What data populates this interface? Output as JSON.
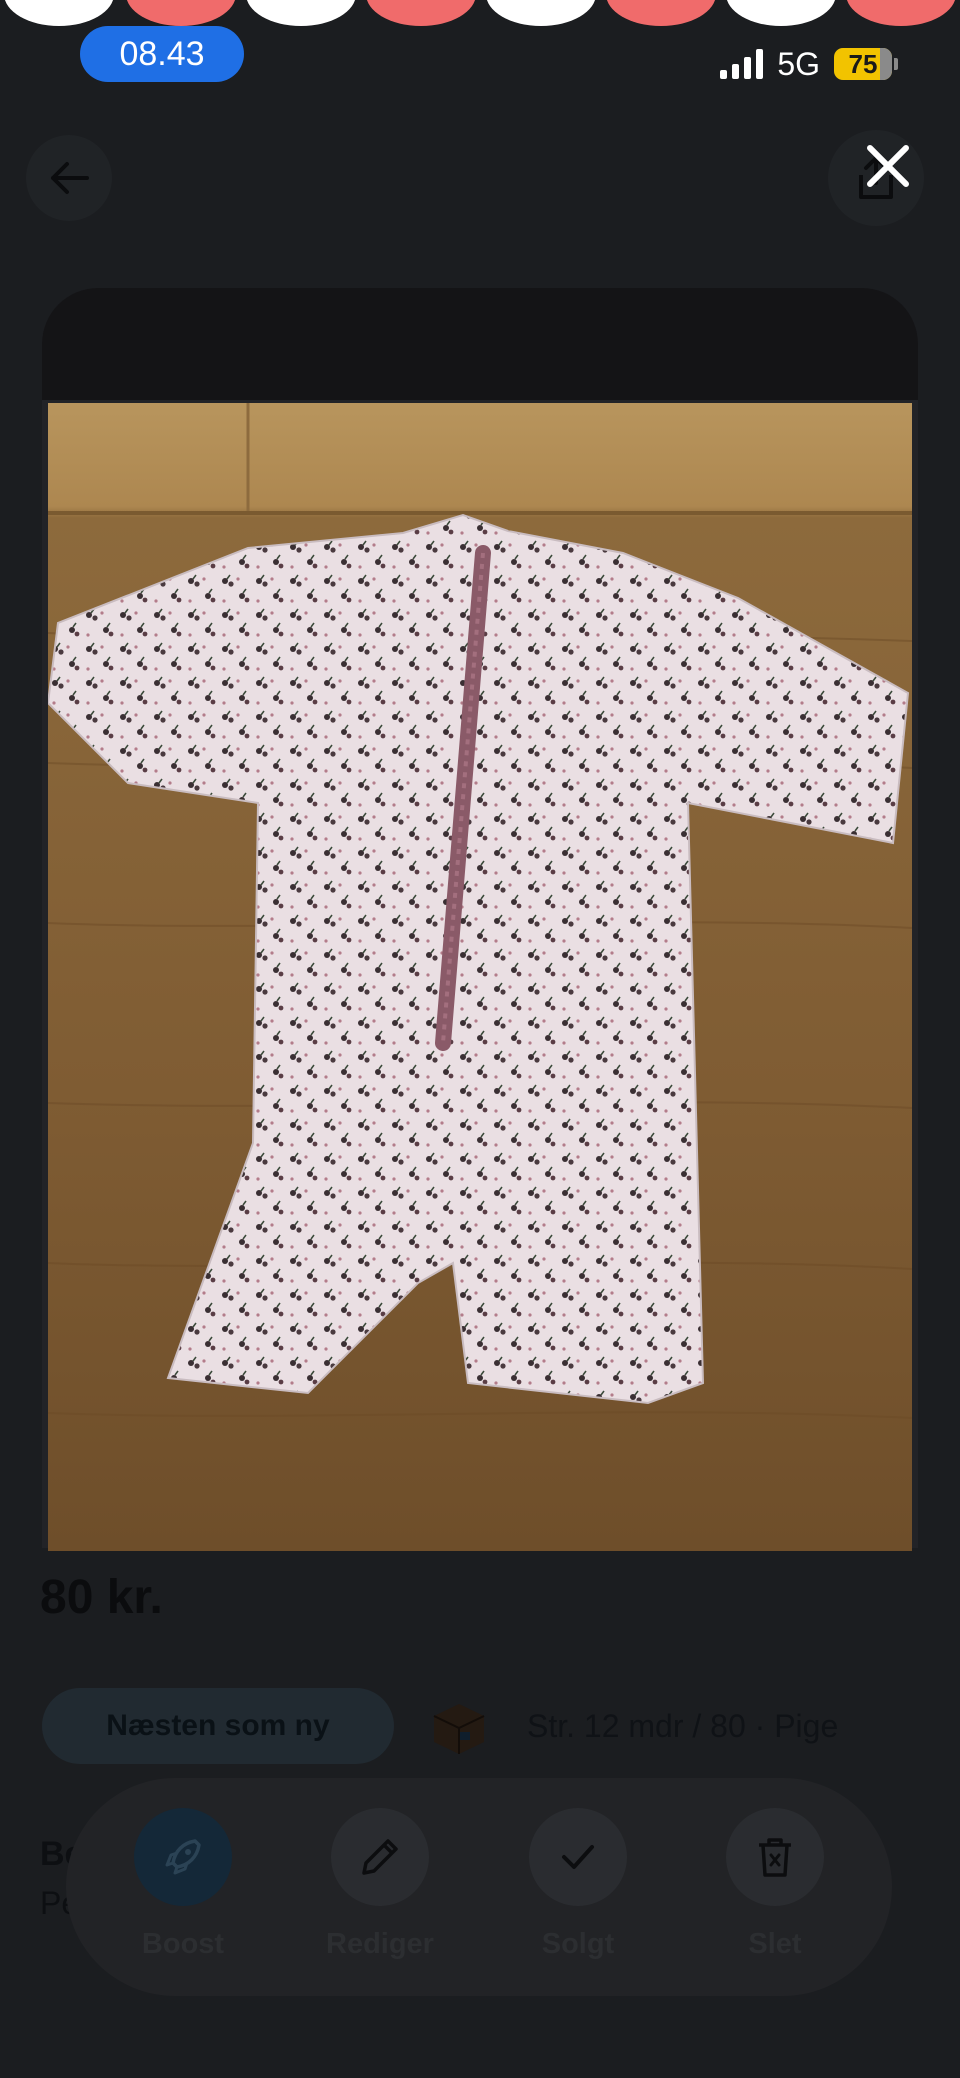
{
  "status_bar": {
    "time": "08.43",
    "network": "5G",
    "battery": "75"
  },
  "colors": {
    "background": "#1b1d20",
    "time_pill": "#1f6fe5",
    "battery": "#f2c300",
    "dot_a": "#ffffff",
    "dot_b": "#f06b6b"
  },
  "icons": {
    "back": "arrow-left-icon",
    "share": "share-icon",
    "close": "close-icon",
    "boost": "rocket-icon",
    "edit": "pencil-icon",
    "sold": "checkmark-icon",
    "delete": "trash-icon"
  },
  "listing": {
    "price": "80 kr.",
    "condition": "Næsten som ny",
    "size": "Str. 12 mdr / 80 · Pige",
    "description_title": "Be",
    "description_body": "Pe"
  },
  "actions": [
    {
      "label": "Boost"
    },
    {
      "label": "Rediger"
    },
    {
      "label": "Solgt"
    },
    {
      "label": "Slet"
    }
  ]
}
